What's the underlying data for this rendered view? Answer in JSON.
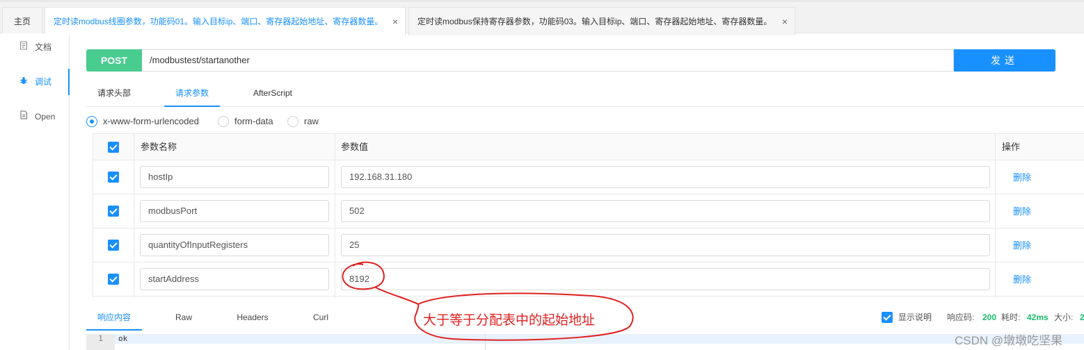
{
  "tabs": [
    {
      "label": "主页"
    },
    {
      "label": "定时读modbus线圈参数，功能码01。输入目标ip、端口、寄存器起始地址、寄存器数量。",
      "close": "×"
    },
    {
      "label": "定时读modbus保持寄存器参数，功能码03。输入目标ip、端口、寄存器起始地址、寄存器数量。",
      "close": "×"
    }
  ],
  "sidenav": [
    {
      "label": "文档",
      "icon": "document-icon"
    },
    {
      "label": "调试",
      "icon": "bug-icon"
    },
    {
      "label": "Open",
      "icon": "file-icon"
    }
  ],
  "request": {
    "method": "POST",
    "url": "/modbustest/startanother",
    "send_label": "发送"
  },
  "subtabs": [
    "请求头部",
    "请求参数",
    "AfterScript"
  ],
  "body_types": [
    "x-www-form-urlencoded",
    "form-data",
    "raw"
  ],
  "table": {
    "headers": {
      "name": "参数名称",
      "value": "参数值",
      "action": "操作"
    },
    "rows": [
      {
        "name": "hostIp",
        "value": "192.168.31.180",
        "action": "删除"
      },
      {
        "name": "modbusPort",
        "value": "502",
        "action": "删除"
      },
      {
        "name": "quantityOfInputRegisters",
        "value": "25",
        "action": "删除"
      },
      {
        "name": "startAddress",
        "value": "8192",
        "action": "删除"
      }
    ]
  },
  "response": {
    "tabs": [
      "响应内容",
      "Raw",
      "Headers",
      "Curl"
    ],
    "show_desc_label": "显示说明",
    "code_label": "响应码:",
    "code_value": "200",
    "time_label": "耗时:",
    "time_value": "42ms",
    "size_label": "大小:",
    "size_value": "2",
    "line_number": "1",
    "body": "ok"
  },
  "annotation": "大于等于分配表中的起始地址",
  "watermark": "CSDN @墩墩吃坚果",
  "colors": {
    "accent": "#1890ff",
    "post": "#49cc90",
    "annotation": "#e02020",
    "success": "#19be6b"
  }
}
